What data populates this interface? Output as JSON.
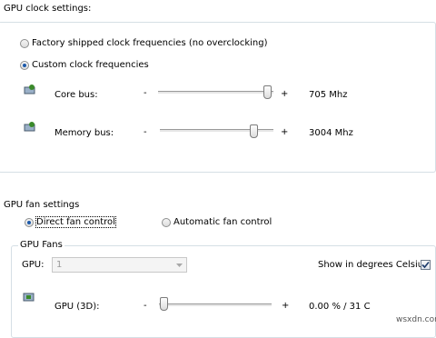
{
  "gpu_clock": {
    "title": "GPU clock settings:",
    "options": [
      {
        "label": "Factory shipped clock frequencies (no overclocking)",
        "selected": false
      },
      {
        "label": "Custom clock frequencies",
        "selected": true
      }
    ],
    "sliders": [
      {
        "label": "Core bus:",
        "minus": "-",
        "plus": "+",
        "value_text": "705 Mhz",
        "level": 0.97
      },
      {
        "label": "Memory bus:",
        "minus": "-",
        "plus": "+",
        "value_text": "3004 Mhz",
        "level": 0.78
      }
    ]
  },
  "gpu_fan": {
    "title": "GPU fan settings",
    "options": [
      {
        "label": "Direct fan control",
        "selected": true
      },
      {
        "label": "Automatic fan control",
        "selected": false
      }
    ],
    "fans_group": {
      "title": "GPU Fans",
      "gpu_label": "GPU:",
      "gpu_select_value": "1",
      "celsius_label": "Show in degrees Celsius",
      "celsius_checked": true,
      "fan_slider": {
        "label": "GPU (3D):",
        "minus": "-",
        "plus": "+",
        "value_text": "0.00 % / 31 C",
        "level": 0.0
      }
    }
  },
  "watermark": "wsxdn.com",
  "colors": {
    "radio_dot": "#1d5aab",
    "group_border": "#d5dfe5",
    "icon_green": "#3a8a2a"
  },
  "icons": {
    "slider_row_icon": "gpu-chip-icon"
  }
}
